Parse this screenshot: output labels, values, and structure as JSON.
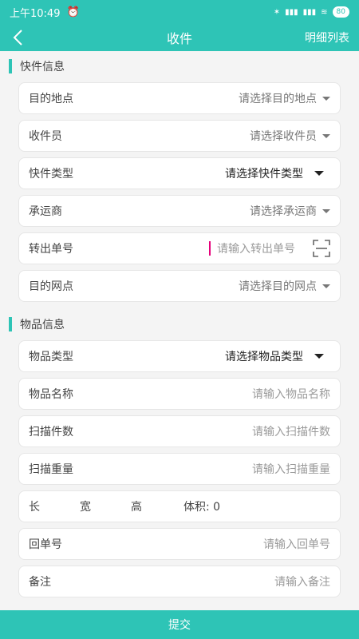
{
  "status": {
    "time": "上午10:49",
    "battery": "80"
  },
  "nav": {
    "title": "收件",
    "detail": "明细列表"
  },
  "sections": {
    "courier": "快件信息",
    "item": "物品信息"
  },
  "courier_rows": [
    {
      "label": "目的地点",
      "value": "请选择目的地点"
    },
    {
      "label": "收件员",
      "value": "请选择收件员"
    },
    {
      "label": "快件类型",
      "value": "请选择快件类型"
    },
    {
      "label": "承运商",
      "value": "请选择承运商"
    },
    {
      "label": "转出单号",
      "placeholder": "请输入转出单号"
    },
    {
      "label": "目的网点",
      "value": "请选择目的网点"
    }
  ],
  "item_rows": [
    {
      "label": "物品类型",
      "value": "请选择物品类型"
    },
    {
      "label": "物品名称",
      "placeholder": "请输入物品名称"
    },
    {
      "label": "扫描件数",
      "placeholder": "请输入扫描件数"
    },
    {
      "label": "扫描重量",
      "placeholder": "请输入扫描重量"
    },
    {
      "len": "长",
      "wid": "宽",
      "hei": "高",
      "vol": "体积: 0"
    },
    {
      "label": "回单号",
      "placeholder": "请输入回单号"
    },
    {
      "label": "备注",
      "placeholder": "请输入备注"
    }
  ],
  "submit": "提交",
  "colors": {
    "accent": "#2ec4b6"
  }
}
